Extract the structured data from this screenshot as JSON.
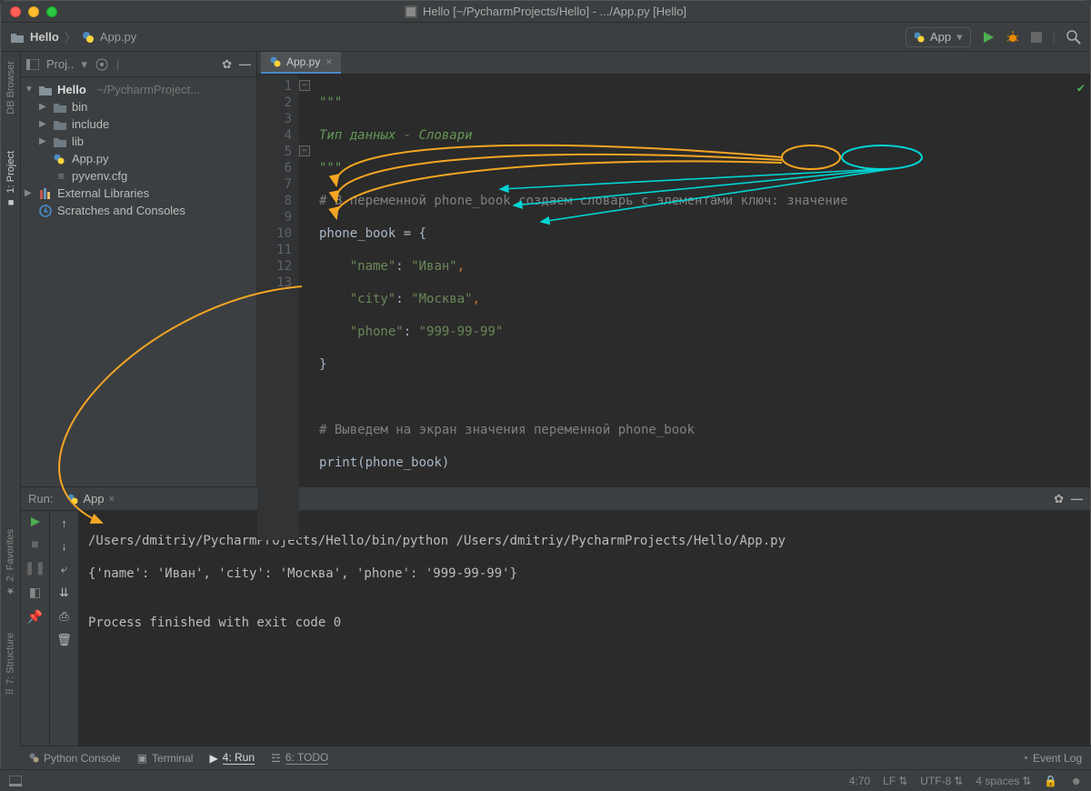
{
  "window": {
    "title": "Hello [~/PycharmProjects/Hello] - .../App.py [Hello]"
  },
  "breadcrumb": {
    "project": "Hello",
    "file": "App.py"
  },
  "run_config": {
    "name": "App"
  },
  "project_panel": {
    "header": "Proj..",
    "root": "Hello",
    "root_path": "~/PycharmProject...",
    "items": [
      "bin",
      "include",
      "lib",
      "App.py",
      "pyvenv.cfg"
    ],
    "external": "External Libraries",
    "scratches": "Scratches and Consoles"
  },
  "left_tabs": {
    "db": "DB Browser",
    "project": "1: Project",
    "favorites": "2: Favorites",
    "structure": "7: Structure"
  },
  "editor": {
    "tab": "App.py",
    "lines": {
      "l1": "\"\"\"",
      "l2": "Тип данных - Словари",
      "l3": "\"\"\"",
      "l4_cmt": "# В переменной phone_book создаем словарь с элементами ",
      "l4_key": "ключ:",
      "l4_val": " значение",
      "l5": "phone_book = {",
      "l6_k": "\"name\"",
      "l6_c": ": ",
      "l6_v": "\"Иван\"",
      "l6_t": ",",
      "l7_k": "\"city\"",
      "l7_c": ": ",
      "l7_v": "\"Москва\"",
      "l7_t": ",",
      "l8_k": "\"phone\"",
      "l8_c": ": ",
      "l8_v": "\"999-99-99\"",
      "l9": "}",
      "l11_cmt": "# Выведем на экран значения переменной phone_book",
      "l12_fn": "print",
      "l12_arg": "(phone_book)"
    }
  },
  "run_panel": {
    "label": "Run:",
    "tab": "App",
    "cmd": "/Users/dmitriy/PycharmProjects/Hello/bin/python /Users/dmitriy/PycharmProjects/Hello/App.py",
    "out": "{'name': 'Иван', 'city': 'Москва', 'phone': '999-99-99'}",
    "exit": "Process finished with exit code 0"
  },
  "bottom_tabs": {
    "console": "Python Console",
    "terminal": "Terminal",
    "run": "4: Run",
    "todo": "6: TODO",
    "eventlog": "Event Log"
  },
  "statusbar": {
    "pos": "4:70",
    "lf": "LF",
    "encoding": "UTF-8",
    "indent": "4 spaces"
  }
}
